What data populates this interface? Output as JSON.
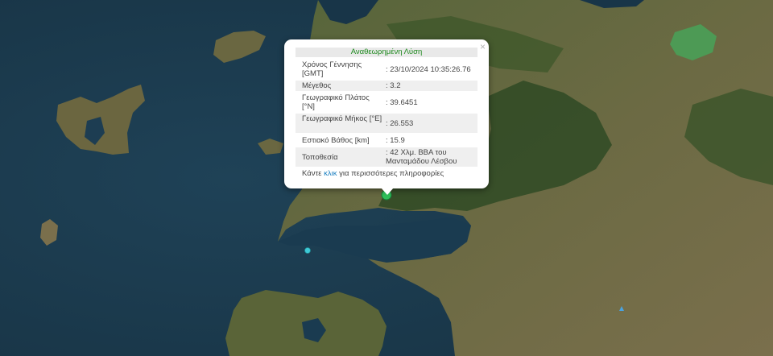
{
  "popup": {
    "title": "Αναθεωρημένη Λύση",
    "close_label": "×",
    "rows": [
      {
        "label": "Χρόνος Γέννησης [GMT]",
        "value": ": 23/10/2024 10:35:26.76"
      },
      {
        "label": "Μέγεθος",
        "value": ": 3.2"
      },
      {
        "label": "Γεωγραφικό Πλάτος [°N]",
        "value": ": 39.6451"
      },
      {
        "label": "Γεωγραφικό Μήκος [°E]",
        "value": ": 26.553"
      },
      {
        "label": "Εστιακό Βάθος [km]",
        "value": ": 15.9"
      },
      {
        "label": "Τοποθεσία",
        "value": ": 42 Χλμ. ΒΒΑ του Μανταμάδου Λέσβου"
      }
    ],
    "more_prefix": "Κάντε ",
    "more_link": "κλικ",
    "more_suffix": " για περισσότερες πληροφορίες"
  },
  "markers": [
    {
      "name": "main-epicenter",
      "color": "#2fbf5a"
    },
    {
      "name": "secondary-epicenter",
      "color": "#3ec9d6"
    }
  ],
  "colors": {
    "sea": "#1d3d52",
    "land": "#5e6a3c",
    "forest": "#2f4a24",
    "lake": "#4d9a55"
  }
}
